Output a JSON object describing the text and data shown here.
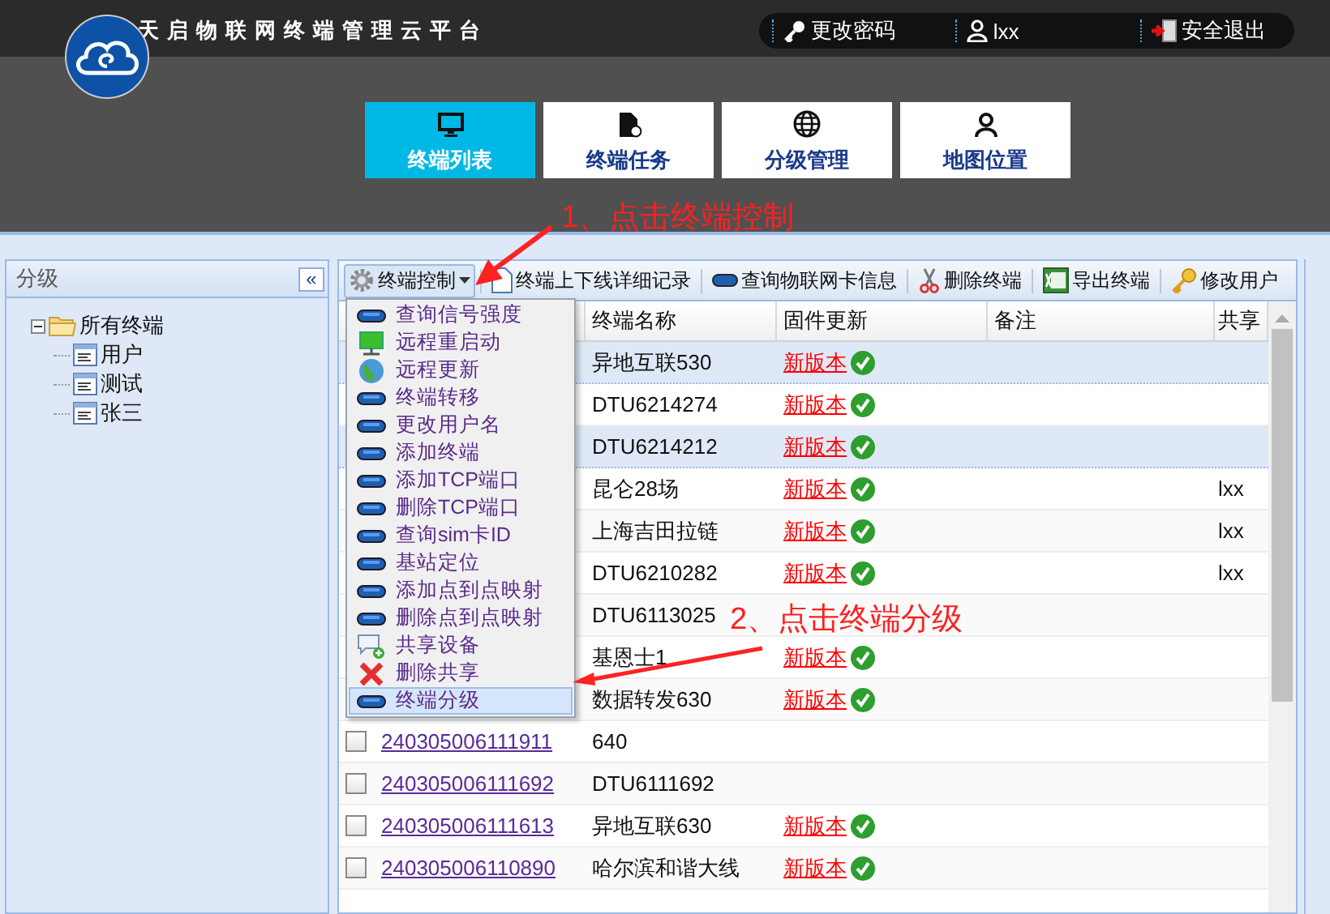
{
  "app_title": "天启物联网终端管理云平台",
  "user_bar": [
    {
      "kind": "key",
      "label": "更改密码"
    },
    {
      "kind": "user",
      "label": "lxx"
    },
    {
      "kind": "exit",
      "label": "安全退出"
    }
  ],
  "nav_tabs": [
    {
      "kind": "monitor",
      "label": "终端列表",
      "selected": true
    },
    {
      "kind": "file",
      "label": "终端任务",
      "selected": false
    },
    {
      "kind": "globe",
      "label": "分级管理",
      "selected": false
    },
    {
      "kind": "person",
      "label": "地图位置",
      "selected": false
    }
  ],
  "sidebar": {
    "title": "分级",
    "collapse": "«",
    "tree": [
      {
        "label": "所有终端",
        "expanded": true,
        "children": [
          {
            "label": "用户"
          },
          {
            "label": "测试"
          },
          {
            "label": "张三"
          }
        ]
      }
    ]
  },
  "toolbar": [
    {
      "kind": "gear",
      "label": "终端控制"
    },
    {
      "kind": "doc",
      "label": "终端上下线详细记录"
    },
    {
      "kind": "card",
      "label": "查询物联网卡信息"
    },
    {
      "kind": "scissors",
      "label": "删除终端"
    },
    {
      "kind": "excel",
      "label": "导出终端"
    },
    {
      "kind": "key",
      "label": "修改用户"
    }
  ],
  "table": {
    "columns": [
      "终端名称",
      "固件更新",
      "备注",
      "共享"
    ],
    "rows": [
      {
        "selected": true,
        "name": "异地互联530",
        "firmware": "新版本"
      },
      {
        "selected": false,
        "name": "DTU6214274",
        "firmware": "新版本"
      },
      {
        "selected": true,
        "name": "DTU6214212",
        "firmware": "新版本"
      },
      {
        "selected": false,
        "name": "昆仑28场",
        "firmware": "新版本",
        "shared": "lxx"
      },
      {
        "selected": false,
        "name": "上海吉田拉链",
        "firmware": "新版本",
        "shared": "lxx"
      },
      {
        "selected": false,
        "name": "DTU6210282",
        "firmware": "新版本",
        "shared": "lxx"
      },
      {
        "selected": false,
        "name": "DTU6113025"
      },
      {
        "selected": false,
        "name": "基恩士1",
        "firmware": "新版本"
      },
      {
        "selected": false,
        "name": "数据转发630",
        "firmware": "新版本"
      },
      {
        "selected": false,
        "checked": false,
        "id": "240305006111911",
        "name": "640"
      },
      {
        "selected": false,
        "checked": false,
        "id": "240305006111692",
        "name": "DTU6111692"
      },
      {
        "selected": false,
        "checked": false,
        "id": "240305006111613",
        "name": "异地互联630",
        "firmware": "新版本"
      },
      {
        "selected": false,
        "checked": false,
        "id": "240305006110890",
        "name": "哈尔滨和谐大线",
        "firmware": "新版本"
      }
    ]
  },
  "control_menu": [
    {
      "kind": "device",
      "label": "查询信号强度",
      "selected": false
    },
    {
      "kind": "monitor",
      "label": "远程重启动",
      "selected": false
    },
    {
      "kind": "globe",
      "label": "远程更新",
      "selected": false
    },
    {
      "kind": "device",
      "label": "终端转移",
      "selected": false
    },
    {
      "kind": "device",
      "label": "更改用户名",
      "selected": false
    },
    {
      "kind": "device",
      "label": "添加终端",
      "selected": false
    },
    {
      "kind": "device",
      "label": "添加TCP端口",
      "selected": false
    },
    {
      "kind": "device",
      "label": "删除TCP端口",
      "selected": false
    },
    {
      "kind": "device",
      "label": "查询sim卡ID",
      "selected": false
    },
    {
      "kind": "device",
      "label": "基站定位",
      "selected": false
    },
    {
      "kind": "device",
      "label": "添加点到点映射",
      "selected": false
    },
    {
      "kind": "device",
      "label": "删除点到点映射",
      "selected": false
    },
    {
      "kind": "share",
      "label": "共享设备",
      "selected": false
    },
    {
      "kind": "delete",
      "label": "删除共享",
      "selected": false
    },
    {
      "kind": "device",
      "label": "终端分级",
      "selected": true
    }
  ],
  "annotations": [
    "1、点击终端控制",
    "2、点击终端分级"
  ]
}
